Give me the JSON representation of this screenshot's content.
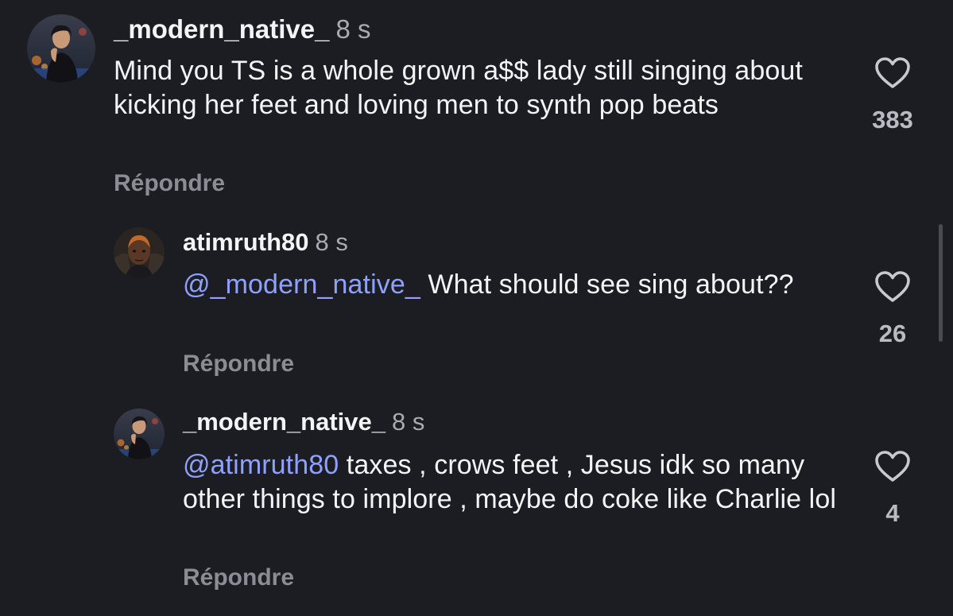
{
  "comments": [
    {
      "username": "_modern_native_",
      "time": "8 s",
      "mention": "",
      "text": "Mind you TS is a whole grown a$$ lady still singing about kicking her feet and loving men to synth pop beats",
      "reply_label": "Répondre",
      "like_count": "383",
      "like_icon": "heart-outline-icon"
    },
    {
      "username": "atimruth80",
      "time": "8 s",
      "mention": "@_modern_native_",
      "text": " What should see sing about??",
      "reply_label": "Répondre",
      "like_count": "26",
      "like_icon": "heart-outline-icon"
    },
    {
      "username": "_modern_native_",
      "time": "8 s",
      "mention": "@atimruth80",
      "text": " taxes , crows feet , Jesus idk so many other things to implore , maybe do coke like Charlie lol",
      "reply_label": "Répondre",
      "like_count": "4",
      "like_icon": "heart-outline-icon"
    }
  ],
  "colors": {
    "background": "#1c1d22",
    "text": "#f4f4f6",
    "secondary_text": "#a9abb2",
    "mention": "#8ea1ff",
    "reply_label": "#8b8d94"
  }
}
